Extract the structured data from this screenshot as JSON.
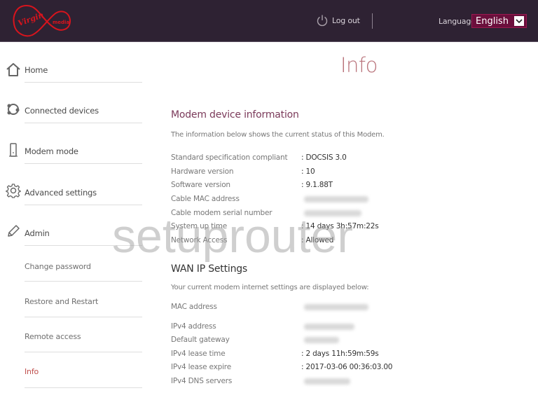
{
  "header": {
    "brand_name": "Virgin media",
    "brand_color": "#e10a0a",
    "logout_label": "Log out",
    "language_label": "Language",
    "language_selected": "English"
  },
  "sidebar": {
    "items": [
      {
        "label": "Home",
        "icon": "home-icon"
      },
      {
        "label": "Connected devices",
        "icon": "devices-icon"
      },
      {
        "label": "Modem mode",
        "icon": "modem-icon"
      },
      {
        "label": "Advanced settings",
        "icon": "gear-icon"
      },
      {
        "label": "Admin",
        "icon": "pencil-icon"
      }
    ],
    "sub_items": [
      {
        "label": "Change password"
      },
      {
        "label": "Restore and Restart"
      },
      {
        "label": "Remote access"
      },
      {
        "label": "Info",
        "active": true
      }
    ]
  },
  "main": {
    "page_title": "Info",
    "modem": {
      "title": "Modem device information",
      "description": "The information below shows the current status of this Modem.",
      "rows": [
        {
          "key": "Standard specification compliant",
          "value": ": DOCSIS 3.0"
        },
        {
          "key": "Hardware version",
          "value": ": 10"
        },
        {
          "key": "Software version",
          "value": ": 9.1.88T"
        },
        {
          "key": "Cable MAC address",
          "value": ""
        },
        {
          "key": "Cable modem serial number",
          "value": ""
        },
        {
          "key": "System up time",
          "value": ": 14 days 3h:57m:22s"
        },
        {
          "key": "Network Access",
          "value": ": Allowed"
        }
      ]
    },
    "wan": {
      "title": "WAN IP Settings",
      "description": "Your current modem internet settings are displayed below:",
      "rows": [
        {
          "key": "MAC address",
          "value": ""
        },
        {
          "key": "IPv4 address",
          "value": ""
        },
        {
          "key": "Default gateway",
          "value": ""
        },
        {
          "key": "IPv4 lease time",
          "value": ": 2 days 11h:59m:59s"
        },
        {
          "key": "IPv4 lease expire",
          "value": ": 2017-03-06 00:36:03.00"
        },
        {
          "key": "IPv4 DNS servers",
          "value": ""
        }
      ]
    }
  },
  "watermark": "setuprouter"
}
